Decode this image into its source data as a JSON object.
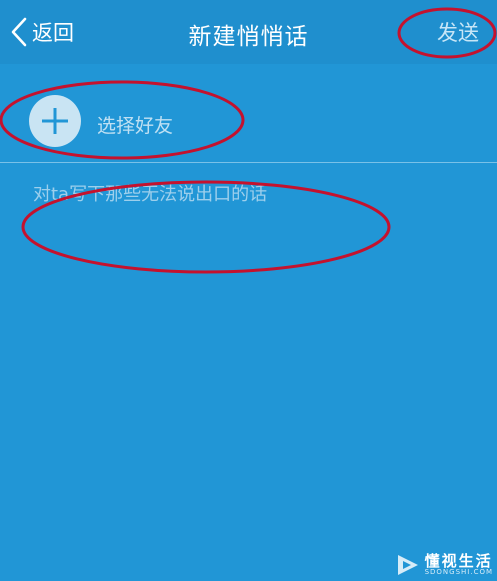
{
  "header": {
    "back_label": "返回",
    "title": "新建悄悄话",
    "send_label": "发送"
  },
  "friend_picker": {
    "label": "选择好友",
    "icon": "plus-icon"
  },
  "composer": {
    "placeholder": "对ta写下那些无法说出口的话",
    "value": ""
  },
  "colors": {
    "background": "#2196d6",
    "topbar": "#1f8fce",
    "annotation": "#c4122e"
  },
  "watermark": {
    "name": "懂视生活",
    "site": "SDONGSHI.COM"
  }
}
